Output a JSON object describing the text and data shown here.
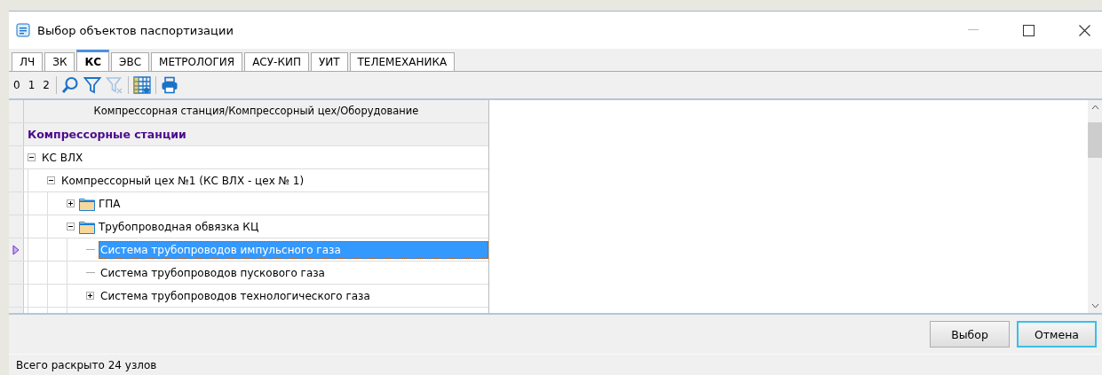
{
  "window": {
    "title": "Выбор объектов паспортизации"
  },
  "tabs": [
    {
      "label": "ЛЧ",
      "selected": false
    },
    {
      "label": "ЗК",
      "selected": false
    },
    {
      "label": "КС",
      "selected": true
    },
    {
      "label": "ЭВС",
      "selected": false
    },
    {
      "label": "МЕТРОЛОГИЯ",
      "selected": false
    },
    {
      "label": "АСУ-КИП",
      "selected": false
    },
    {
      "label": "УИТ",
      "selected": false
    },
    {
      "label": "ТЕЛЕМЕХАНИКА",
      "selected": false
    }
  ],
  "toolbar": [
    {
      "kind": "text",
      "label": "0"
    },
    {
      "kind": "text",
      "label": "1"
    },
    {
      "kind": "text",
      "label": "2"
    },
    {
      "kind": "separator"
    },
    {
      "kind": "search",
      "disabled": false
    },
    {
      "kind": "filter",
      "disabled": false
    },
    {
      "kind": "clear-filter",
      "disabled": true
    },
    {
      "kind": "separator"
    },
    {
      "kind": "grid",
      "disabled": false
    },
    {
      "kind": "separator"
    },
    {
      "kind": "print",
      "disabled": false
    }
  ],
  "grid": {
    "column": "Компрессорная станция/Компрессорный цех/Оборудование",
    "group": "Компрессорные станции",
    "tree": [
      {
        "label": "КС ВЛХ",
        "expanded": true,
        "folder": false,
        "selected": false,
        "children": [
          {
            "label": "Компрессорный цех №1 (КС ВЛХ - цех № 1)",
            "expanded": true,
            "folder": false,
            "selected": false,
            "children": [
              {
                "label": "ГПА",
                "expanded": false,
                "folder": true,
                "selected": false
              },
              {
                "label": "Трубопроводная обвязка КЦ",
                "expanded": true,
                "folder": true,
                "selected": false,
                "children": [
                  {
                    "label": "Система трубопроводов импульсного газа",
                    "folder": false,
                    "selected": true
                  },
                  {
                    "label": "Система трубопроводов пускового газа",
                    "folder": false,
                    "selected": false
                  },
                  {
                    "label": "Система трубопроводов технологического газа",
                    "expanded": false,
                    "folder": false,
                    "selected": false
                  }
                ]
              }
            ]
          }
        ]
      }
    ]
  },
  "buttons": [
    {
      "label": "Выбор",
      "focused": false
    },
    {
      "label": "Отмена",
      "focused": true
    }
  ],
  "status_bar": "Всего раскрыто 24 узлов"
}
